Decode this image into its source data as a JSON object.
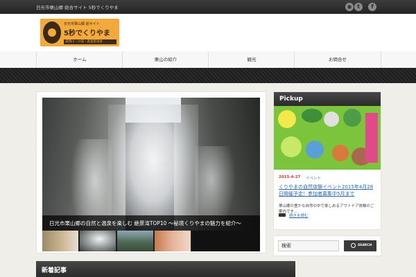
{
  "topbar": {
    "tagline": "日光市栗山郷 総合サイト 5秒でくりやま",
    "social": [
      {
        "icon": "rss-icon",
        "glyph": "◉"
      },
      {
        "icon": "twitter-icon",
        "glyph": "t"
      },
      {
        "icon": "facebook-icon",
        "glyph": "f"
      }
    ]
  },
  "logo": {
    "sub": "日光市栗山郷 総サイト",
    "main": "5秒でくりやま",
    "bottom": "湯西川・川俣・奥鬼怒温泉",
    "color": "#f3a93c"
  },
  "nav": {
    "items": [
      "ホーム",
      "栗山の紹介",
      "観光",
      "お問合せ"
    ]
  },
  "slider": {
    "caption": "日光市栗山郷の自然と温泉を楽しむ 絶景滝TOP10 ～秘境くりやまの魅力を紹介～"
  },
  "pickup": {
    "heading": "Pickup",
    "date": "2015-4-27",
    "category": "イベント",
    "title": "くりやまの自然体験イベント2015年4月28日開催予定！参加者募集中5月まで",
    "excerpt": "栗山郷の豊かな自然の中で楽しめるアウトドア体験のご案内です…",
    "more": "続きを読む"
  },
  "search": {
    "value": "検索",
    "button": "SEARCH"
  },
  "section": {
    "heading": "新着記事"
  }
}
